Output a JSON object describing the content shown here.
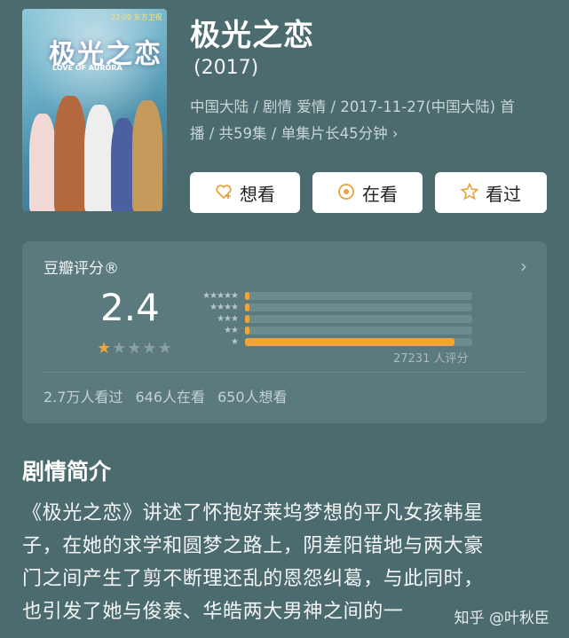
{
  "header": {
    "title": "极光之恋",
    "year": "(2017)",
    "meta_line1": "中国大陆 / 剧情 爱情 / 2017-11-27(中国大陆) 首",
    "meta_line2": "播 / 共59集 / 单集片长45分钟 ›"
  },
  "poster": {
    "title_text": "极光之恋",
    "subtitle": "LOVE OF AURORA",
    "top_text": "22:00 东方卫视"
  },
  "actions": {
    "want": {
      "label": "想看",
      "icon": "heart-plus-icon"
    },
    "watching": {
      "label": "在看",
      "icon": "target-icon"
    },
    "watched": {
      "label": "看过",
      "icon": "star-outline-icon"
    }
  },
  "rating": {
    "heading": "豆瓣评分®",
    "score": "2.4",
    "stars_filled": 1,
    "stars_total": 5,
    "distribution_fraction": [
      0.02,
      0.02,
      0.02,
      0.02,
      0.92
    ],
    "count": "27231 人评分",
    "watched": "2.7万人看过",
    "watching": "646人在看",
    "want": "650人想看",
    "accent_color": "#f0a53a"
  },
  "synopsis": {
    "heading": "剧情简介",
    "line1": "《极光之恋》讲述了怀抱好莱坞梦想的平凡女孩韩星",
    "line2": "子，在她的求学和圆梦之路上，阴差阳错地与两大豪",
    "line3": "门之间产生了剪不断理还乱的恩怨纠葛，与此同时，",
    "line4": "也引发了她与俊泰、华皓两大男神之间的一"
  },
  "watermark": "知乎 @叶秋臣"
}
